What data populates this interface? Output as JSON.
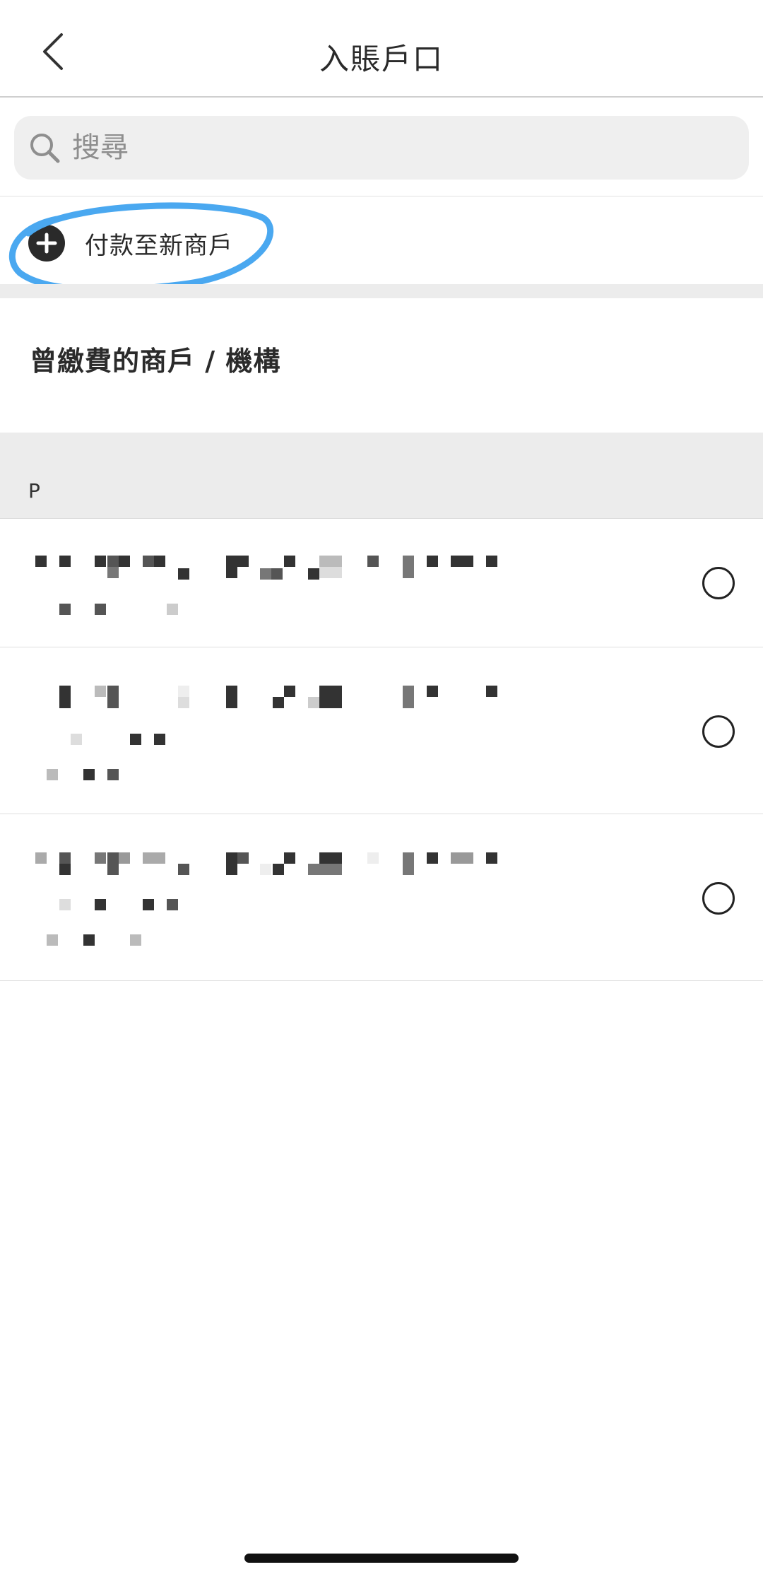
{
  "header": {
    "title": "入賬戶口",
    "back_icon": "chevron-left-icon"
  },
  "search": {
    "placeholder": "搜尋",
    "icon": "search-icon"
  },
  "new_merchant": {
    "label": "付款至新商戶",
    "icon": "plus-circle-icon"
  },
  "section": {
    "title": "曾繳費的商戶 / 機構"
  },
  "index": {
    "letter": "P"
  },
  "list": [
    {
      "name": "",
      "selected": false
    },
    {
      "name": "",
      "selected": false
    },
    {
      "name": "",
      "selected": false
    }
  ],
  "colors": {
    "highlight_ring": "#4aa8f0",
    "band": "#ececec",
    "dark": "#2a2a2a"
  }
}
